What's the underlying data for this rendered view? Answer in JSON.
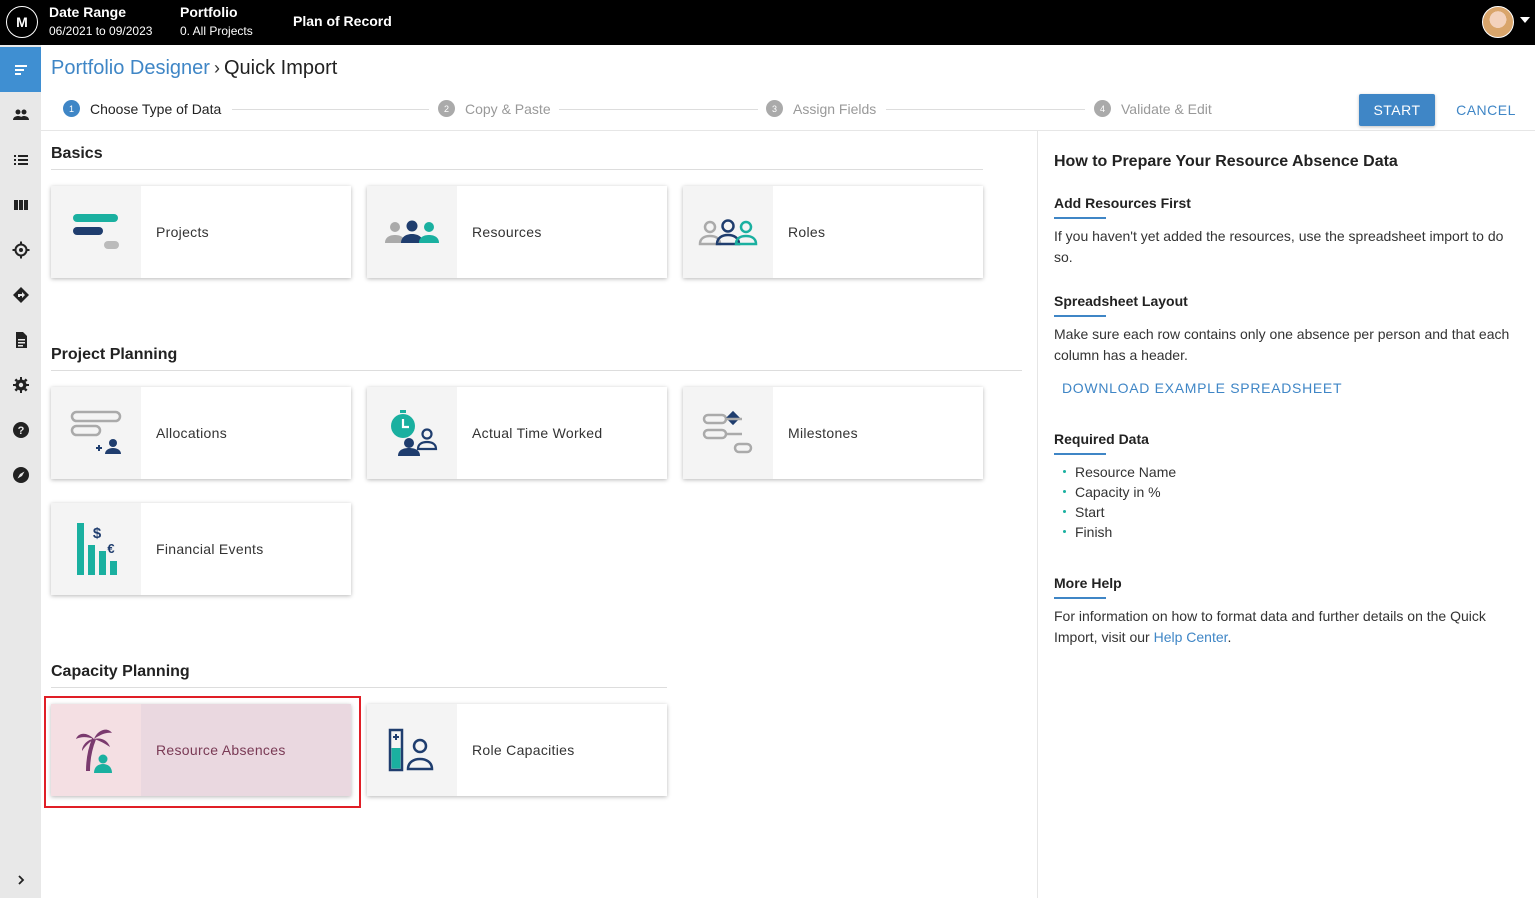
{
  "topbar": {
    "logo_text": "M",
    "date_range_label": "Date Range",
    "date_range_value": "06/2021 to 09/2023",
    "portfolio_label": "Portfolio",
    "portfolio_value": "0. All Projects",
    "plan_label": "Plan of Record"
  },
  "breadcrumb": {
    "parent": "Portfolio Designer",
    "separator": "›",
    "current": "Quick Import"
  },
  "stepper": {
    "steps": [
      {
        "num": "1",
        "label": "Choose Type of Data",
        "active": true
      },
      {
        "num": "2",
        "label": "Copy & Paste",
        "active": false
      },
      {
        "num": "3",
        "label": "Assign Fields",
        "active": false
      },
      {
        "num": "4",
        "label": "Validate & Edit",
        "active": false
      }
    ],
    "start_label": "START",
    "cancel_label": "CANCEL"
  },
  "sections": {
    "basics": {
      "title": "Basics",
      "cards": [
        {
          "label": "Projects",
          "icon": "projects-icon"
        },
        {
          "label": "Resources",
          "icon": "resources-icon"
        },
        {
          "label": "Roles",
          "icon": "roles-icon"
        }
      ]
    },
    "project_planning": {
      "title": "Project Planning",
      "cards": [
        {
          "label": "Allocations",
          "icon": "allocations-icon"
        },
        {
          "label": "Actual Time Worked",
          "icon": "actual-time-icon"
        },
        {
          "label": "Milestones",
          "icon": "milestones-icon"
        },
        {
          "label": "Financial Events",
          "icon": "financial-events-icon"
        }
      ]
    },
    "capacity_planning": {
      "title": "Capacity Planning",
      "cards": [
        {
          "label": "Resource Absences",
          "icon": "palm-tree-icon",
          "selected": true
        },
        {
          "label": "Role Capacities",
          "icon": "role-capacities-icon"
        }
      ]
    }
  },
  "right_panel": {
    "title": "How to Prepare Your Resource Absence Data",
    "add_resources_heading": "Add Resources First",
    "add_resources_text": "If you haven't yet added the resources, use the spreadsheet import to do so.",
    "layout_heading": "Spreadsheet Layout",
    "layout_text": "Make sure each row contains only one absence per person and that each column has a header.",
    "download_link": "DOWNLOAD EXAMPLE SPREADSHEET",
    "required_heading": "Required Data",
    "required_items": [
      "Resource Name",
      "Capacity in %",
      "Start",
      "Finish"
    ],
    "more_help_heading": "More Help",
    "more_help_text": "For information on how to format data and further details on the Quick Import, visit our ",
    "help_center_link": "Help Center",
    "more_help_end": "."
  },
  "colors": {
    "accent": "#3f86c6",
    "teal": "#1ab0a0",
    "navy": "#1f3d6e",
    "selection_outline": "#e01e26",
    "selected_card_bg": "#ead8e0"
  },
  "leftnav_icons": [
    "menu-icon",
    "people-icon",
    "list-icon",
    "columns-icon",
    "target-icon",
    "diamond-direction-icon",
    "document-icon",
    "gear-icon",
    "help-icon",
    "compass-icon",
    "chevron-right-icon"
  ]
}
